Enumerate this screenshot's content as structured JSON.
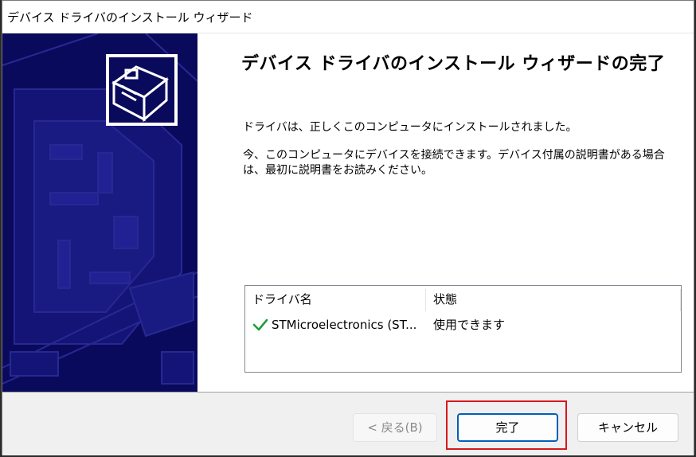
{
  "window": {
    "title": "デバイス ドライバのインストール ウィザード"
  },
  "content": {
    "heading": "デバイス ドライバのインストール ウィザードの完了",
    "message": "ドライバは、正しくこのコンピュータにインストールされました。",
    "instructions": "今、このコンピュータにデバイスを接続できます。デバイス付属の説明書がある場合は、最初に説明書をお読みください。"
  },
  "driver_table": {
    "columns": [
      "ドライバ名",
      "状態"
    ],
    "rows": [
      {
        "name": "STMicroelectronics (ST...",
        "status": "使用できます",
        "icon": "checkmark-icon"
      }
    ]
  },
  "buttons": {
    "back": "< 戻る(B)",
    "finish": "完了",
    "cancel": "キャンセル"
  },
  "colors": {
    "sidebar_background": "#0a0a5c",
    "check_green": "#1e9e3e",
    "focus_border": "#005fb8",
    "annotation_red": "#d7191c"
  }
}
